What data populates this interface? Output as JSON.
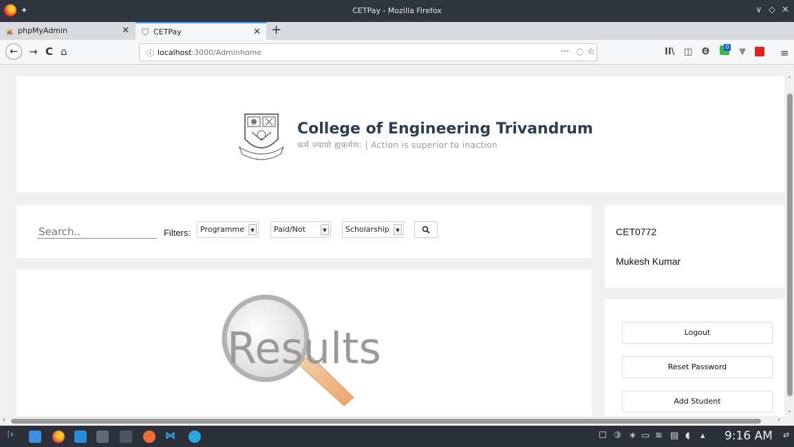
{
  "window": {
    "title": "CETPay - Mozilla Firefox",
    "controls": [
      "∨",
      "◇",
      "✕"
    ]
  },
  "tabs": [
    {
      "label": "phpMyAdmin",
      "close": "✕"
    },
    {
      "label": "CETPay",
      "close": "✕"
    }
  ],
  "newtab": "+",
  "nav": {
    "back": "←",
    "forward": "→",
    "reload": "C",
    "home": "⌂",
    "url_host": "localhost",
    "url_path": ":3000/Adminhome",
    "info_icon": "ⓘ",
    "more": "···",
    "pocket": "◌",
    "bookmark": "☆"
  },
  "toolbar": {
    "library": "II\\",
    "sidebar": "◫",
    "account": "Θ",
    "badge": "0",
    "menu": "≡"
  },
  "header": {
    "college_name": "College of Engineering Trivandrum",
    "motto": "कर्म ज्यायो ह्यकर्मण: | Action is superior to inaction"
  },
  "filters": {
    "search_placeholder": "Search..",
    "label": "Filters:",
    "programme": "Programme",
    "paid": "Paid/Not",
    "scholarship": "Scholarship",
    "arrow": "▼"
  },
  "results": {
    "text": "Results"
  },
  "user": {
    "id": "CET0772",
    "name": "Mukesh Kumar"
  },
  "actions": {
    "logout": "Logout",
    "reset": "Reset Password",
    "add": "Add Student"
  },
  "taskbar": {
    "clock": "9:16 AM"
  }
}
